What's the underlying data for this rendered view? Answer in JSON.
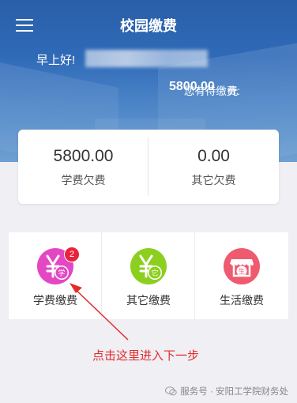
{
  "header": {
    "title": "校园缴费",
    "greeting": "早上好!",
    "pending_label": "您有待缴费:",
    "pending_amount": "5800.00",
    "pending_unit": "元"
  },
  "arrears": [
    {
      "amount": "5800.00",
      "label": "学费欠费"
    },
    {
      "amount": "0.00",
      "label": "其它欠费"
    }
  ],
  "payments": [
    {
      "label": "学费缴费",
      "icon": "tuition-yen-icon",
      "icon_char": "学",
      "color": "#e447c4",
      "badge": "2"
    },
    {
      "label": "其它缴费",
      "icon": "other-yen-icon",
      "icon_char": "它",
      "color": "#8ccf1f"
    },
    {
      "label": "生活缴费",
      "icon": "shop-icon",
      "icon_char": "生",
      "color": "#f05a6e"
    }
  ],
  "hint": "点击这里进入下一步",
  "footer": {
    "source": "服务号 · 安阳工学院财务处"
  },
  "colors": {
    "header_blue": "#2f6ab8",
    "hint_red": "#e32b2b",
    "badge_red": "#e8233a"
  }
}
